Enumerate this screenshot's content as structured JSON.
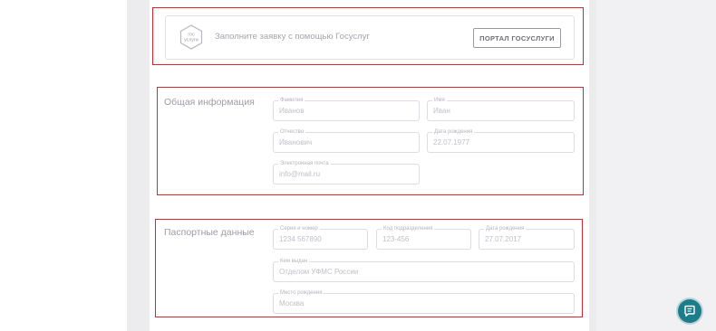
{
  "gosuslugi": {
    "logo_text": [
      "гос",
      "услуги"
    ],
    "prompt": "Заполните заявку с помощью Госуслуг",
    "button_label": "ПОРТАЛ ГОСУСЛУГИ"
  },
  "general_info": {
    "title": "Общая информация",
    "fields": {
      "last_name": {
        "label": "Фамилия",
        "placeholder": "Иванов"
      },
      "first_name": {
        "label": "Имя",
        "placeholder": "Иван"
      },
      "patronymic": {
        "label": "Отчество",
        "placeholder": "Иванович"
      },
      "birth_date": {
        "label": "Дата рождения",
        "placeholder": "22.07.1977"
      },
      "email": {
        "label": "Электронная почта",
        "placeholder": "info@mail.ru"
      }
    }
  },
  "passport": {
    "title": "Паспортные данные",
    "fields": {
      "series_number": {
        "label": "Серия и номер",
        "placeholder": "1234 567890"
      },
      "division_code": {
        "label": "Код подразделения",
        "placeholder": "123-456"
      },
      "issue_date": {
        "label": "Дата рождения",
        "placeholder": "27.07.2017"
      },
      "issued_by": {
        "label": "Кем выдан",
        "placeholder": "Отделом УФМС России"
      },
      "birth_place": {
        "label": "Место рождения",
        "placeholder": "Москва"
      }
    }
  },
  "colors": {
    "highlight_border": "#d9252b",
    "chat_button": "#1c7d8a"
  },
  "icons": {
    "gosuslugi_logo": "gosuslugi-logo",
    "chat": "chat-icon"
  }
}
